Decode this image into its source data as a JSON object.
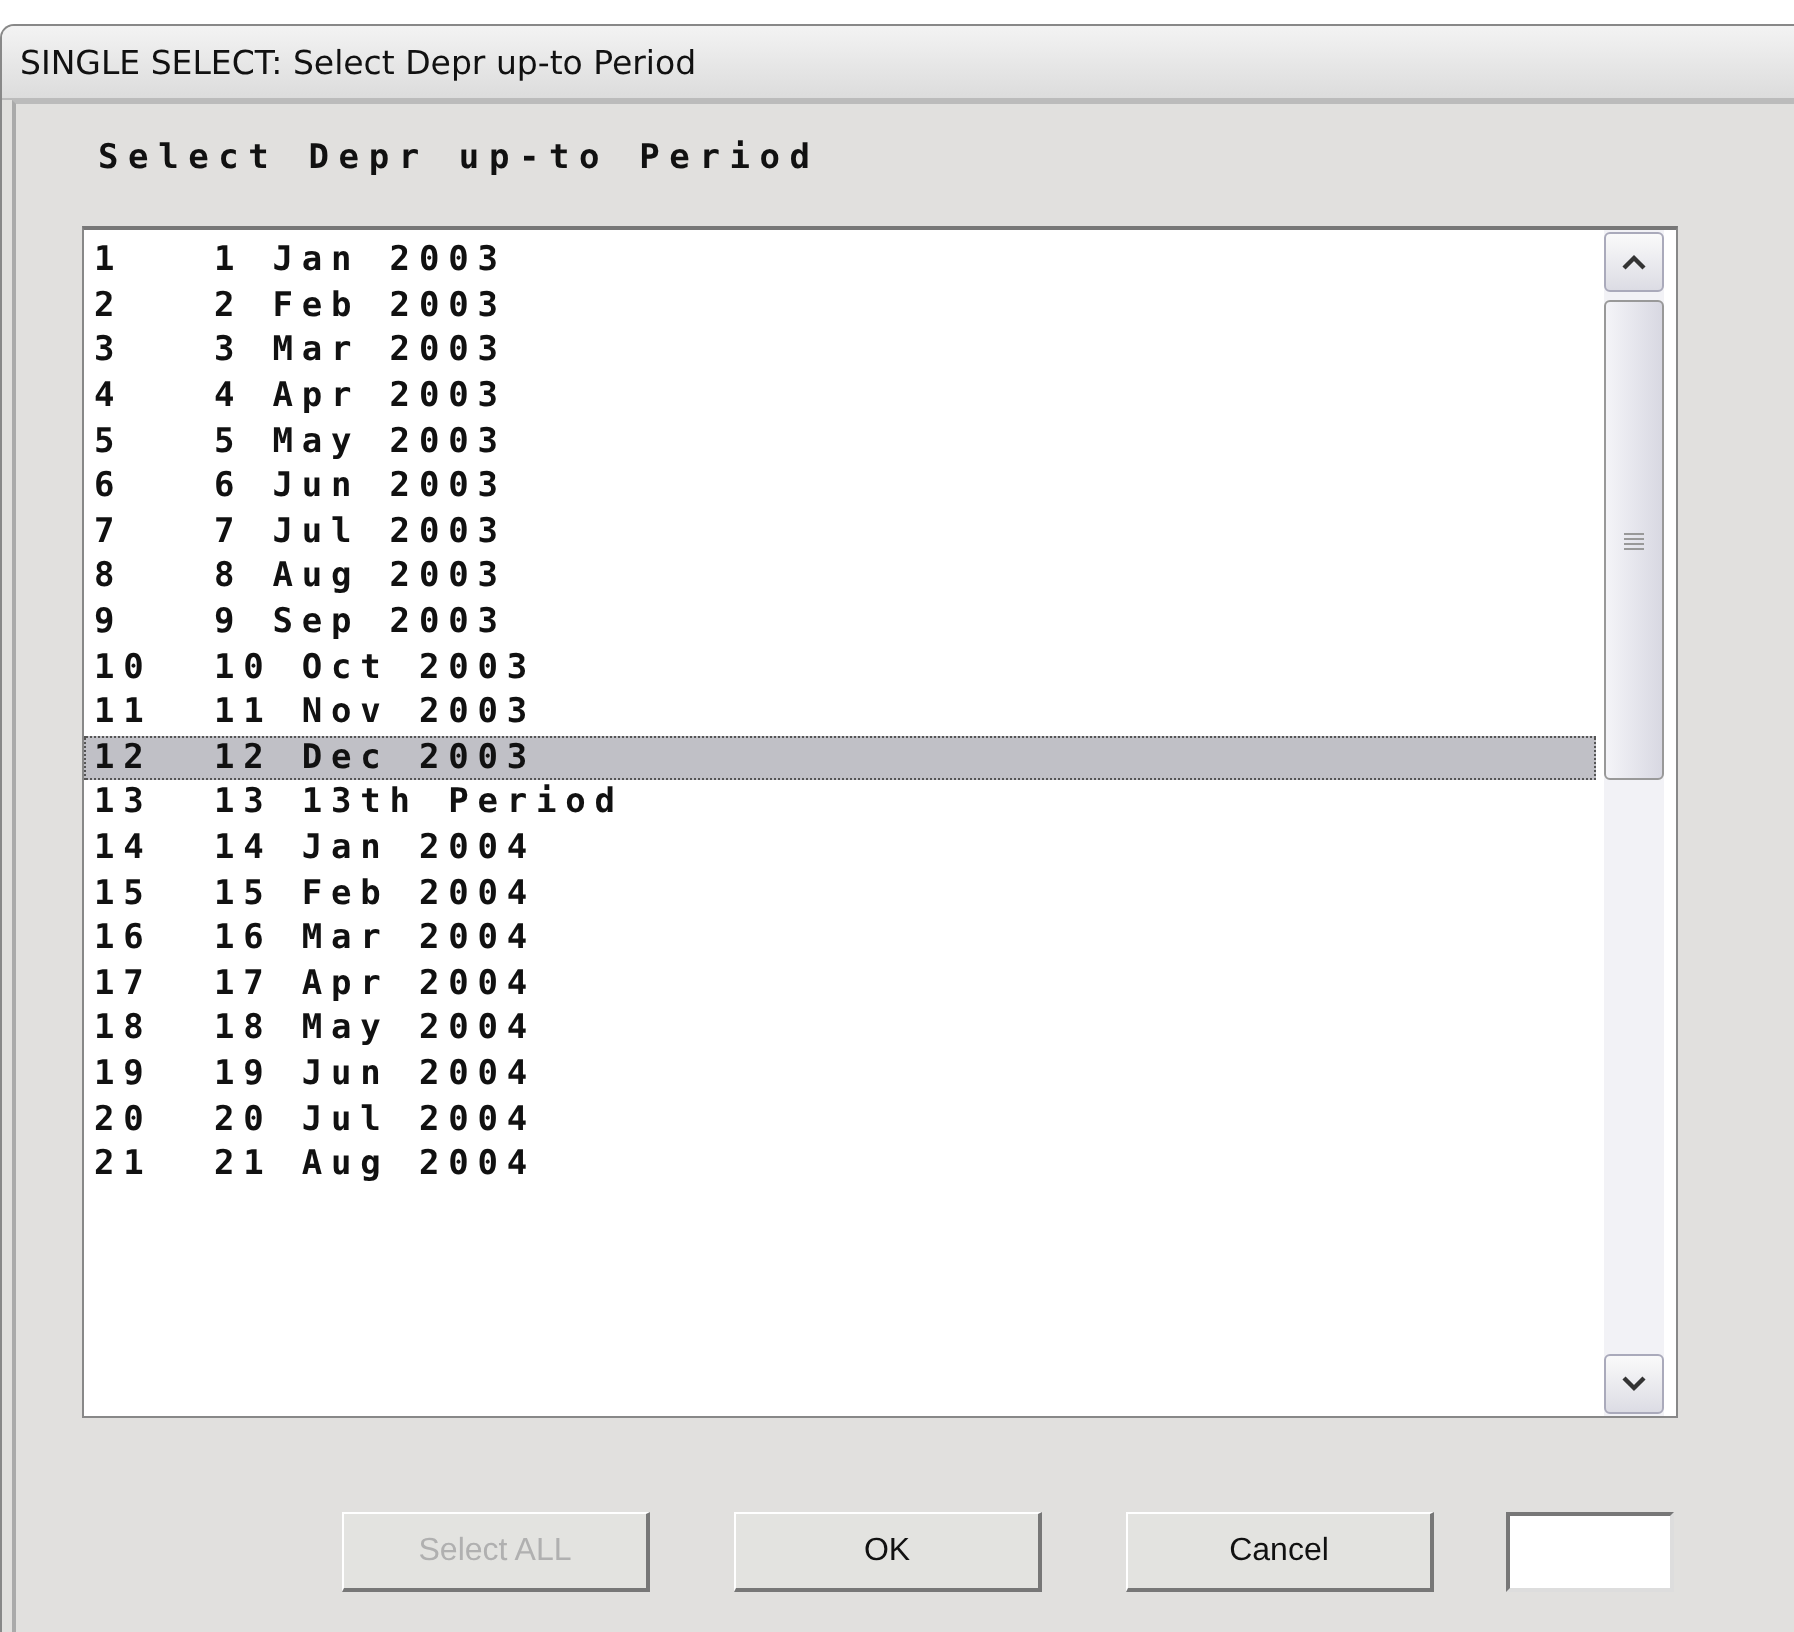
{
  "window": {
    "title": "SINGLE SELECT: Select Depr up-to Period"
  },
  "heading": "Select Depr up-to Period",
  "list": {
    "rows": [
      {
        "number": "1",
        "label": "1 Jan 2003",
        "selected": false
      },
      {
        "number": "2",
        "label": "2 Feb 2003",
        "selected": false
      },
      {
        "number": "3",
        "label": "3 Mar 2003",
        "selected": false
      },
      {
        "number": "4",
        "label": "4 Apr 2003",
        "selected": false
      },
      {
        "number": "5",
        "label": "5 May 2003",
        "selected": false
      },
      {
        "number": "6",
        "label": "6 Jun 2003",
        "selected": false
      },
      {
        "number": "7",
        "label": "7 Jul 2003",
        "selected": false
      },
      {
        "number": "8",
        "label": "8 Aug 2003",
        "selected": false
      },
      {
        "number": "9",
        "label": "9 Sep 2003",
        "selected": false
      },
      {
        "number": "10",
        "label": "10 Oct 2003",
        "selected": false
      },
      {
        "number": "11",
        "label": "11 Nov 2003",
        "selected": false
      },
      {
        "number": "12",
        "label": "12 Dec 2003",
        "selected": true
      },
      {
        "number": "13",
        "label": "13 13th Period",
        "selected": false
      },
      {
        "number": "14",
        "label": "14 Jan 2004",
        "selected": false
      },
      {
        "number": "15",
        "label": "15 Feb 2004",
        "selected": false
      },
      {
        "number": "16",
        "label": "16 Mar 2004",
        "selected": false
      },
      {
        "number": "17",
        "label": "17 Apr 2004",
        "selected": false
      },
      {
        "number": "18",
        "label": "18 May 2004",
        "selected": false
      },
      {
        "number": "19",
        "label": "19 Jun 2004",
        "selected": false
      },
      {
        "number": "20",
        "label": "20 Jul 2004",
        "selected": false
      },
      {
        "number": "21",
        "label": "21 Aug 2004",
        "selected": false
      }
    ]
  },
  "buttons": [
    {
      "label": "Select ALL",
      "disabled": true
    },
    {
      "label": "OK",
      "disabled": false
    },
    {
      "label": "Cancel",
      "disabled": false
    }
  ]
}
